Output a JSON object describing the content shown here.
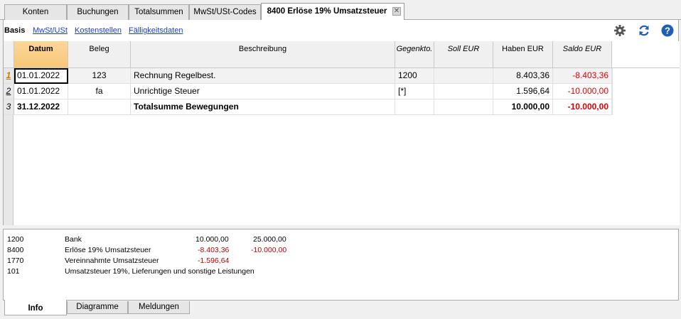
{
  "tabs": [
    {
      "label": "Konten"
    },
    {
      "label": "Buchungen"
    },
    {
      "label": "Totalsummen"
    },
    {
      "label": "MwSt/USt-Codes"
    },
    {
      "label": "8400 Erlöse 19% Umsatzsteuer",
      "active": true
    }
  ],
  "subnav": {
    "items": [
      {
        "label": "Basis",
        "active": true
      },
      {
        "label": "MwSt/USt"
      },
      {
        "label": "Kostenstellen"
      },
      {
        "label": "Fälligkeitsdaten"
      }
    ]
  },
  "toolbar": {
    "settings_icon": "gear-icon",
    "refresh_icon": "refresh-icon",
    "help_icon": "help-icon",
    "accent_color": "#1e5fb4"
  },
  "table": {
    "columns": [
      {
        "label": "Datum"
      },
      {
        "label": "Beleg"
      },
      {
        "label": "Beschreibung"
      },
      {
        "label": "Gegenkto."
      },
      {
        "label": "Soll EUR"
      },
      {
        "label": "Haben EUR"
      },
      {
        "label": "Saldo EUR"
      }
    ],
    "rows": [
      {
        "num": "1",
        "datum": "01.01.2022",
        "beleg": "123",
        "beschreibung": "Rechnung Regelbest.",
        "gegenkto": "1200",
        "soll": "",
        "haben": "8.403,36",
        "saldo": "-8.403,36"
      },
      {
        "num": "2",
        "datum": "01.01.2022",
        "beleg": "fa",
        "beschreibung": "Unrichtige Steuer",
        "gegenkto": "[*]",
        "soll": "",
        "haben": "1.596,64",
        "saldo": "-10.000,00"
      },
      {
        "num": "3",
        "datum": "31.12.2022",
        "beleg": "",
        "beschreibung": "Totalsumme Bewegungen",
        "gegenkto": "",
        "soll": "",
        "haben": "10.000,00",
        "saldo": "-10.000,00"
      }
    ],
    "negative_color": "#e00000"
  },
  "info": {
    "rows": [
      {
        "account": "1200",
        "name": "Bank",
        "value1": "10.000,00",
        "value2": "25.000,00"
      },
      {
        "account": "8400",
        "name": "Erlöse 19% Umsatzsteuer",
        "value1": "-8.403,36",
        "value2": "-10.000,00"
      },
      {
        "account": "1770",
        "name": "Vereinnahmte Umsatzsteuer",
        "value1": "-1.596,64",
        "value2": ""
      },
      {
        "account": "101",
        "name": "Umsatzsteuer 19%, Lieferungen und sonstige Leistungen",
        "value1": "",
        "value2": ""
      }
    ]
  },
  "bottom_tabs": [
    {
      "label": "Info",
      "active": true
    },
    {
      "label": "Diagramme"
    },
    {
      "label": "Meldungen"
    }
  ]
}
